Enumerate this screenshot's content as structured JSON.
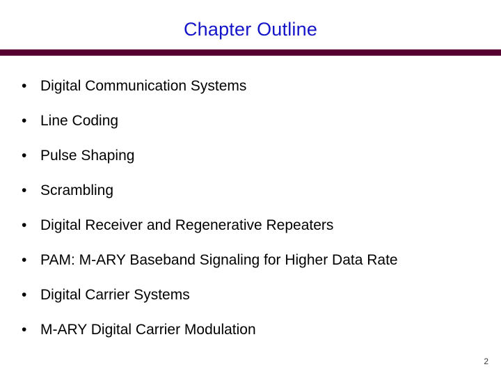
{
  "slide": {
    "title": "Chapter Outline",
    "page_number": "2",
    "bullet_glyph": "•",
    "colors": {
      "title": "#1414c8",
      "rule": "#550030",
      "body_text": "#000000",
      "background": "#ffffff",
      "page_number": "#3a3a3a"
    },
    "bullets": [
      {
        "text": "Digital Communication Systems"
      },
      {
        "text": "Line Coding"
      },
      {
        "text": "Pulse Shaping"
      },
      {
        "text": "Scrambling"
      },
      {
        "text": "Digital Receiver and Regenerative Repeaters"
      },
      {
        "text": "PAM: M-ARY Baseband Signaling for Higher Data Rate"
      },
      {
        "text": "Digital Carrier Systems"
      },
      {
        "text": "M-ARY Digital Carrier Modulation"
      }
    ]
  }
}
